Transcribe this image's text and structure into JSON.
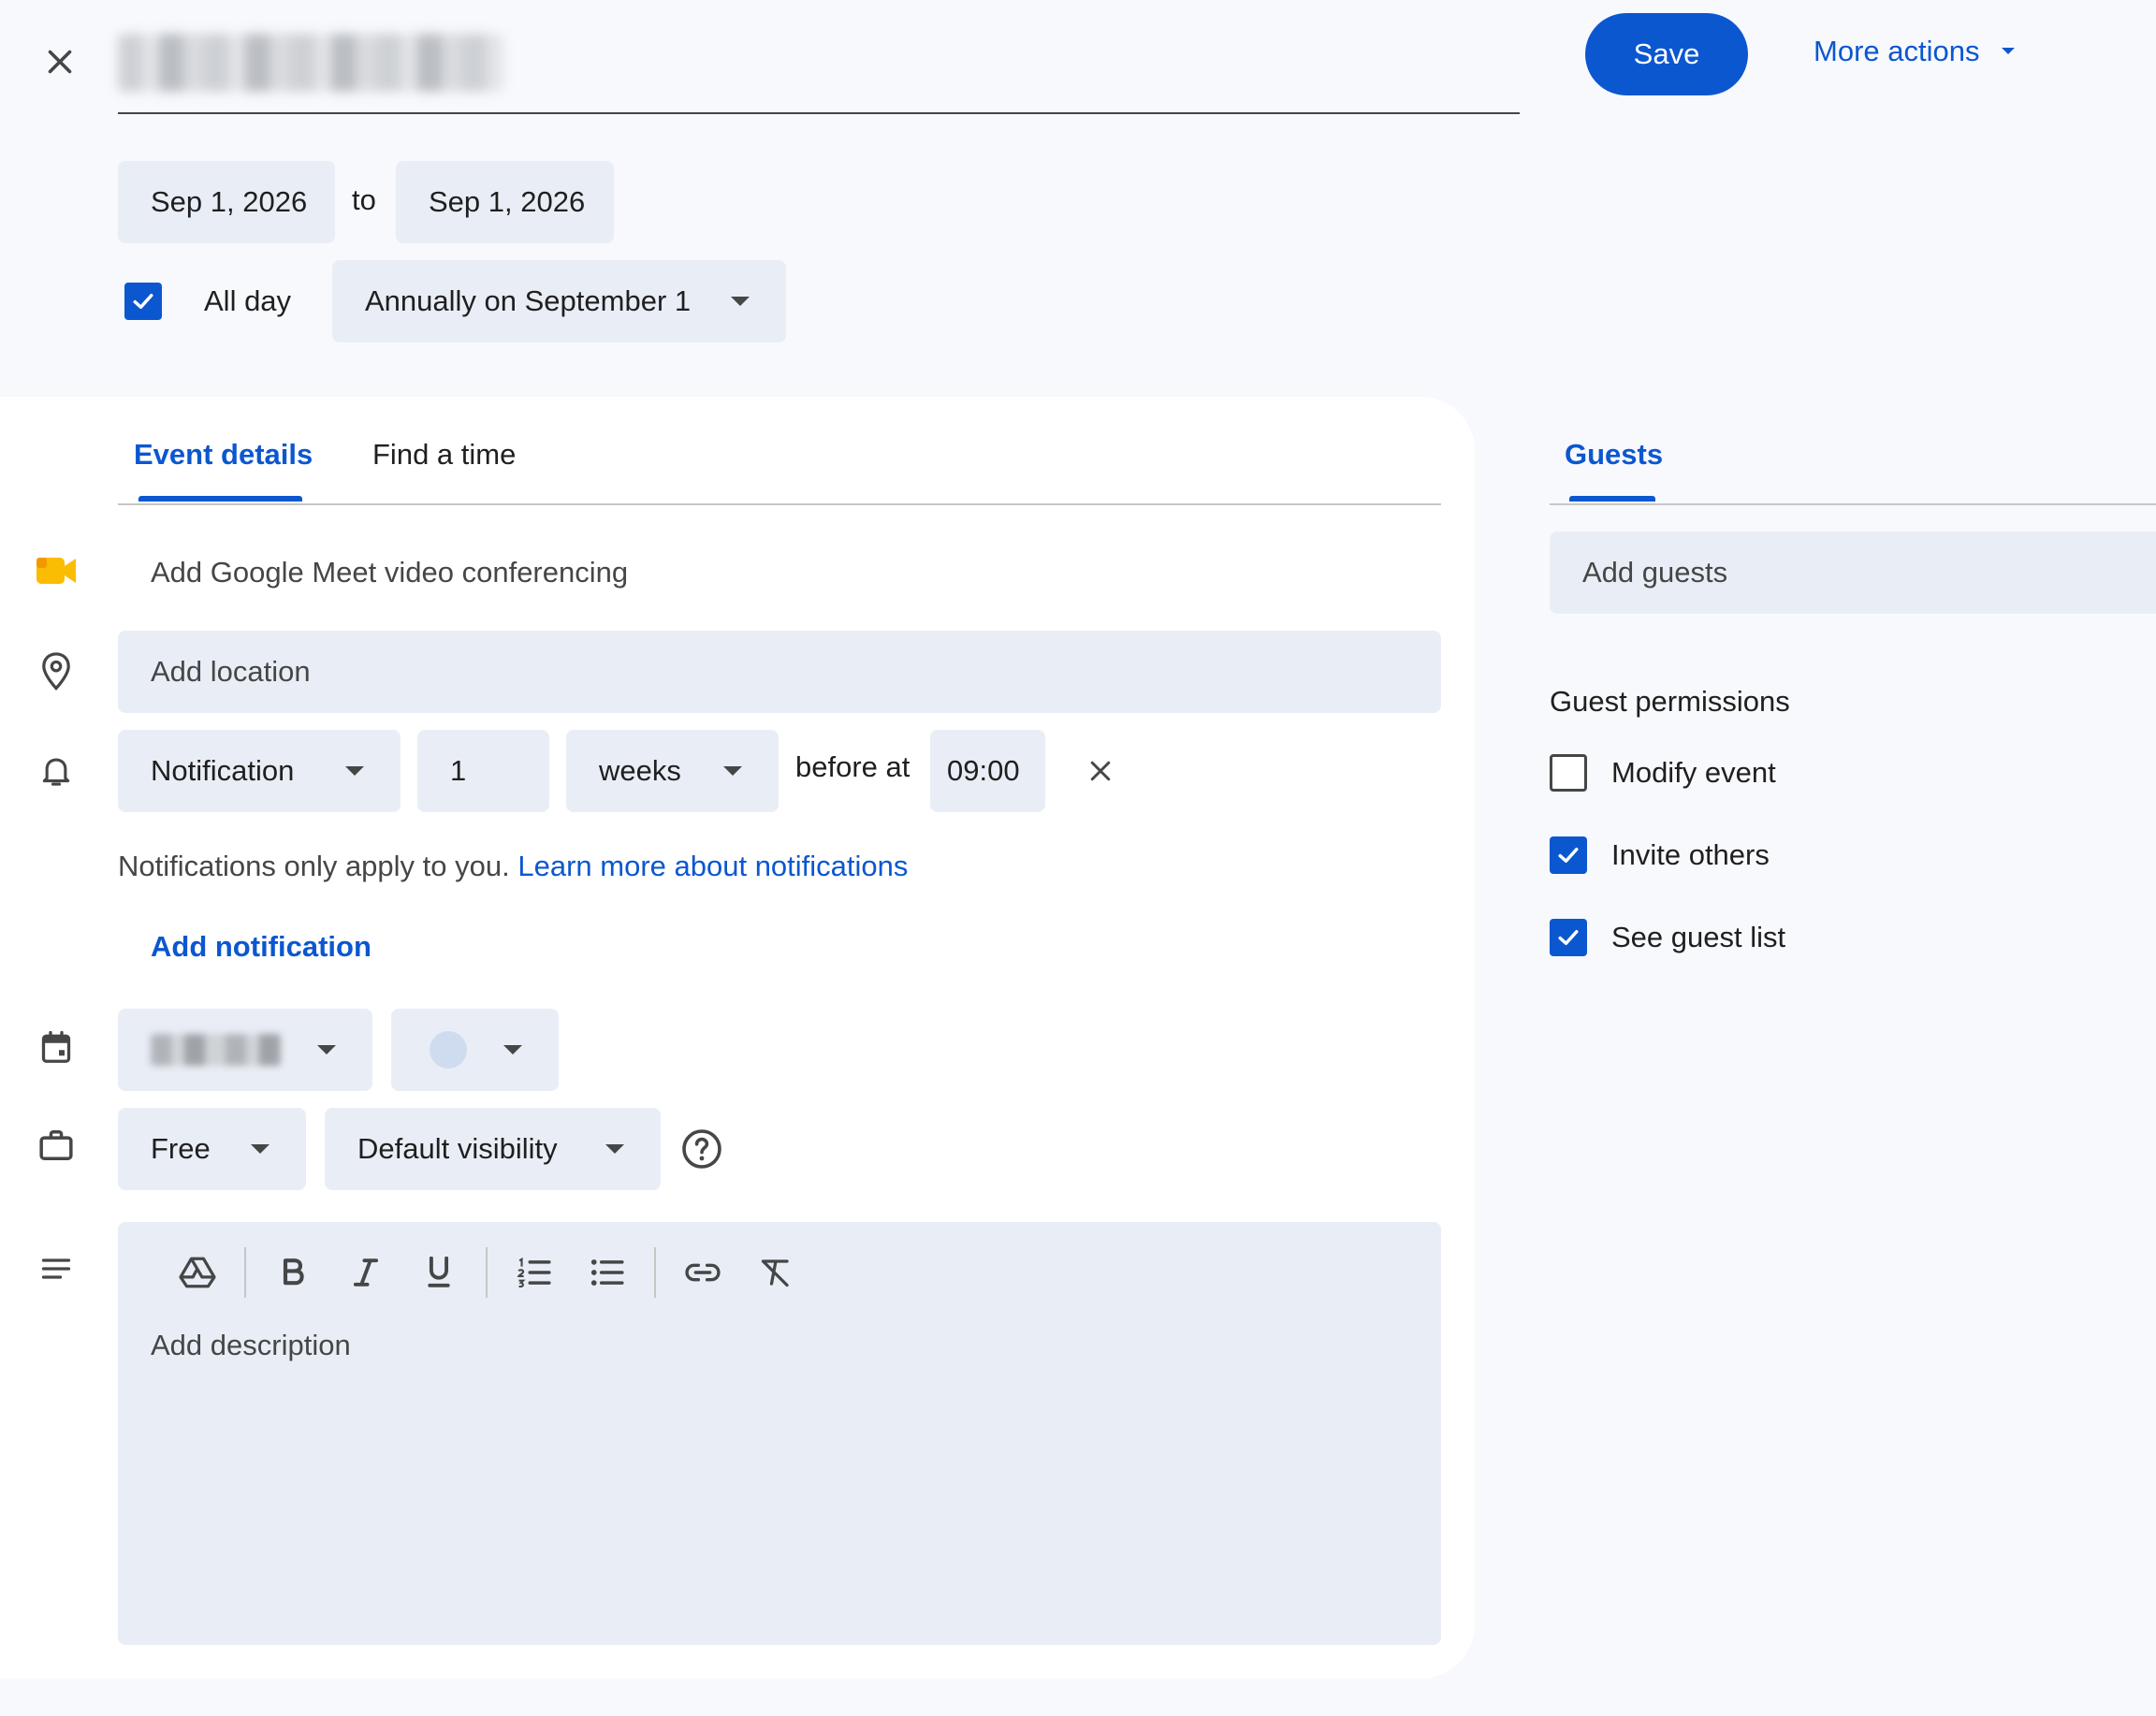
{
  "header": {
    "save_label": "Save",
    "more_actions_label": "More actions"
  },
  "dates": {
    "start": "Sep 1, 2026",
    "to_label": "to",
    "end": "Sep 1, 2026",
    "all_day_label": "All day",
    "all_day_checked": true,
    "recurrence": "Annually on September 1"
  },
  "tabs": {
    "event_details": "Event details",
    "find_a_time": "Find a time"
  },
  "details": {
    "meet_label": "Add Google Meet video conferencing",
    "location_placeholder": "Add location",
    "notification_type": "Notification",
    "notification_value": "1",
    "notification_unit": "weeks",
    "before_at_label": "before at",
    "notification_time": "09:00",
    "notif_info_text": "Notifications only apply to you.",
    "notif_info_link": "Learn more about notifications",
    "add_notification_label": "Add notification",
    "availability": "Free",
    "visibility": "Default visibility",
    "description_placeholder": "Add description"
  },
  "guests": {
    "tab_label": "Guests",
    "add_guests_placeholder": "Add guests",
    "permissions_title": "Guest permissions",
    "permissions": [
      {
        "label": "Modify event",
        "checked": false
      },
      {
        "label": "Invite others",
        "checked": true
      },
      {
        "label": "See guest list",
        "checked": true
      }
    ]
  },
  "colors": {
    "accent": "#0b57d0",
    "meet_yellow": "#fbbc04",
    "field_bg": "#e9eef6",
    "page_bg": "#f8f9fd"
  },
  "icons": {
    "close": "close-icon",
    "meet": "video-camera-icon",
    "location": "location-pin-icon",
    "notification": "bell-icon",
    "calendar": "calendar-icon",
    "availability": "briefcase-icon",
    "description": "notes-icon",
    "help": "help-icon"
  }
}
